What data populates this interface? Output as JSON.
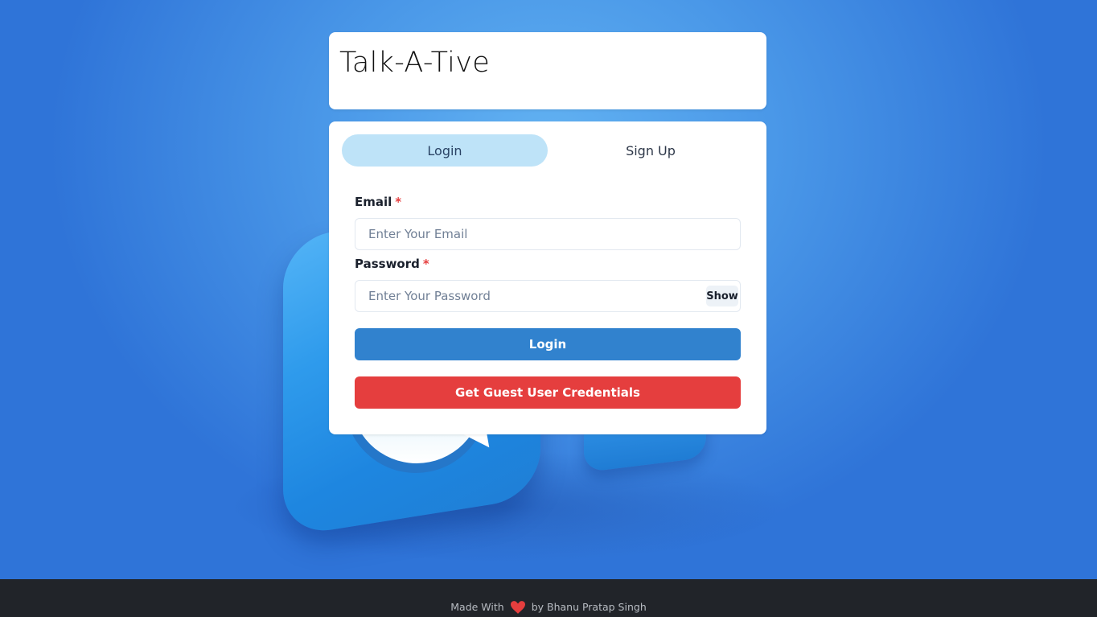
{
  "app": {
    "title": "Talk-A-Tive"
  },
  "tabs": [
    {
      "label": "Login",
      "active": true
    },
    {
      "label": "Sign Up",
      "active": false
    }
  ],
  "form": {
    "email_label": "Email",
    "email_required_marker": "*",
    "email_placeholder": "Enter Your Email",
    "email_value": "",
    "password_label": "Password",
    "password_required_marker": "*",
    "password_placeholder": "Enter Your Password",
    "password_value": "",
    "show_label": "Show",
    "login_button": "Login",
    "guest_button": "Get Guest User Credentials"
  },
  "footer": {
    "prefix": "Made With",
    "heart_icon": "heart-icon",
    "suffix": "by Bhanu Pratap Singh"
  },
  "colors": {
    "tab_active_bg": "#bee3f8",
    "login_button": "#3182ce",
    "guest_button": "#e53e3e",
    "required_marker": "#e53e3e",
    "footer_bg": "#212429",
    "heart": "#e53e3e"
  }
}
